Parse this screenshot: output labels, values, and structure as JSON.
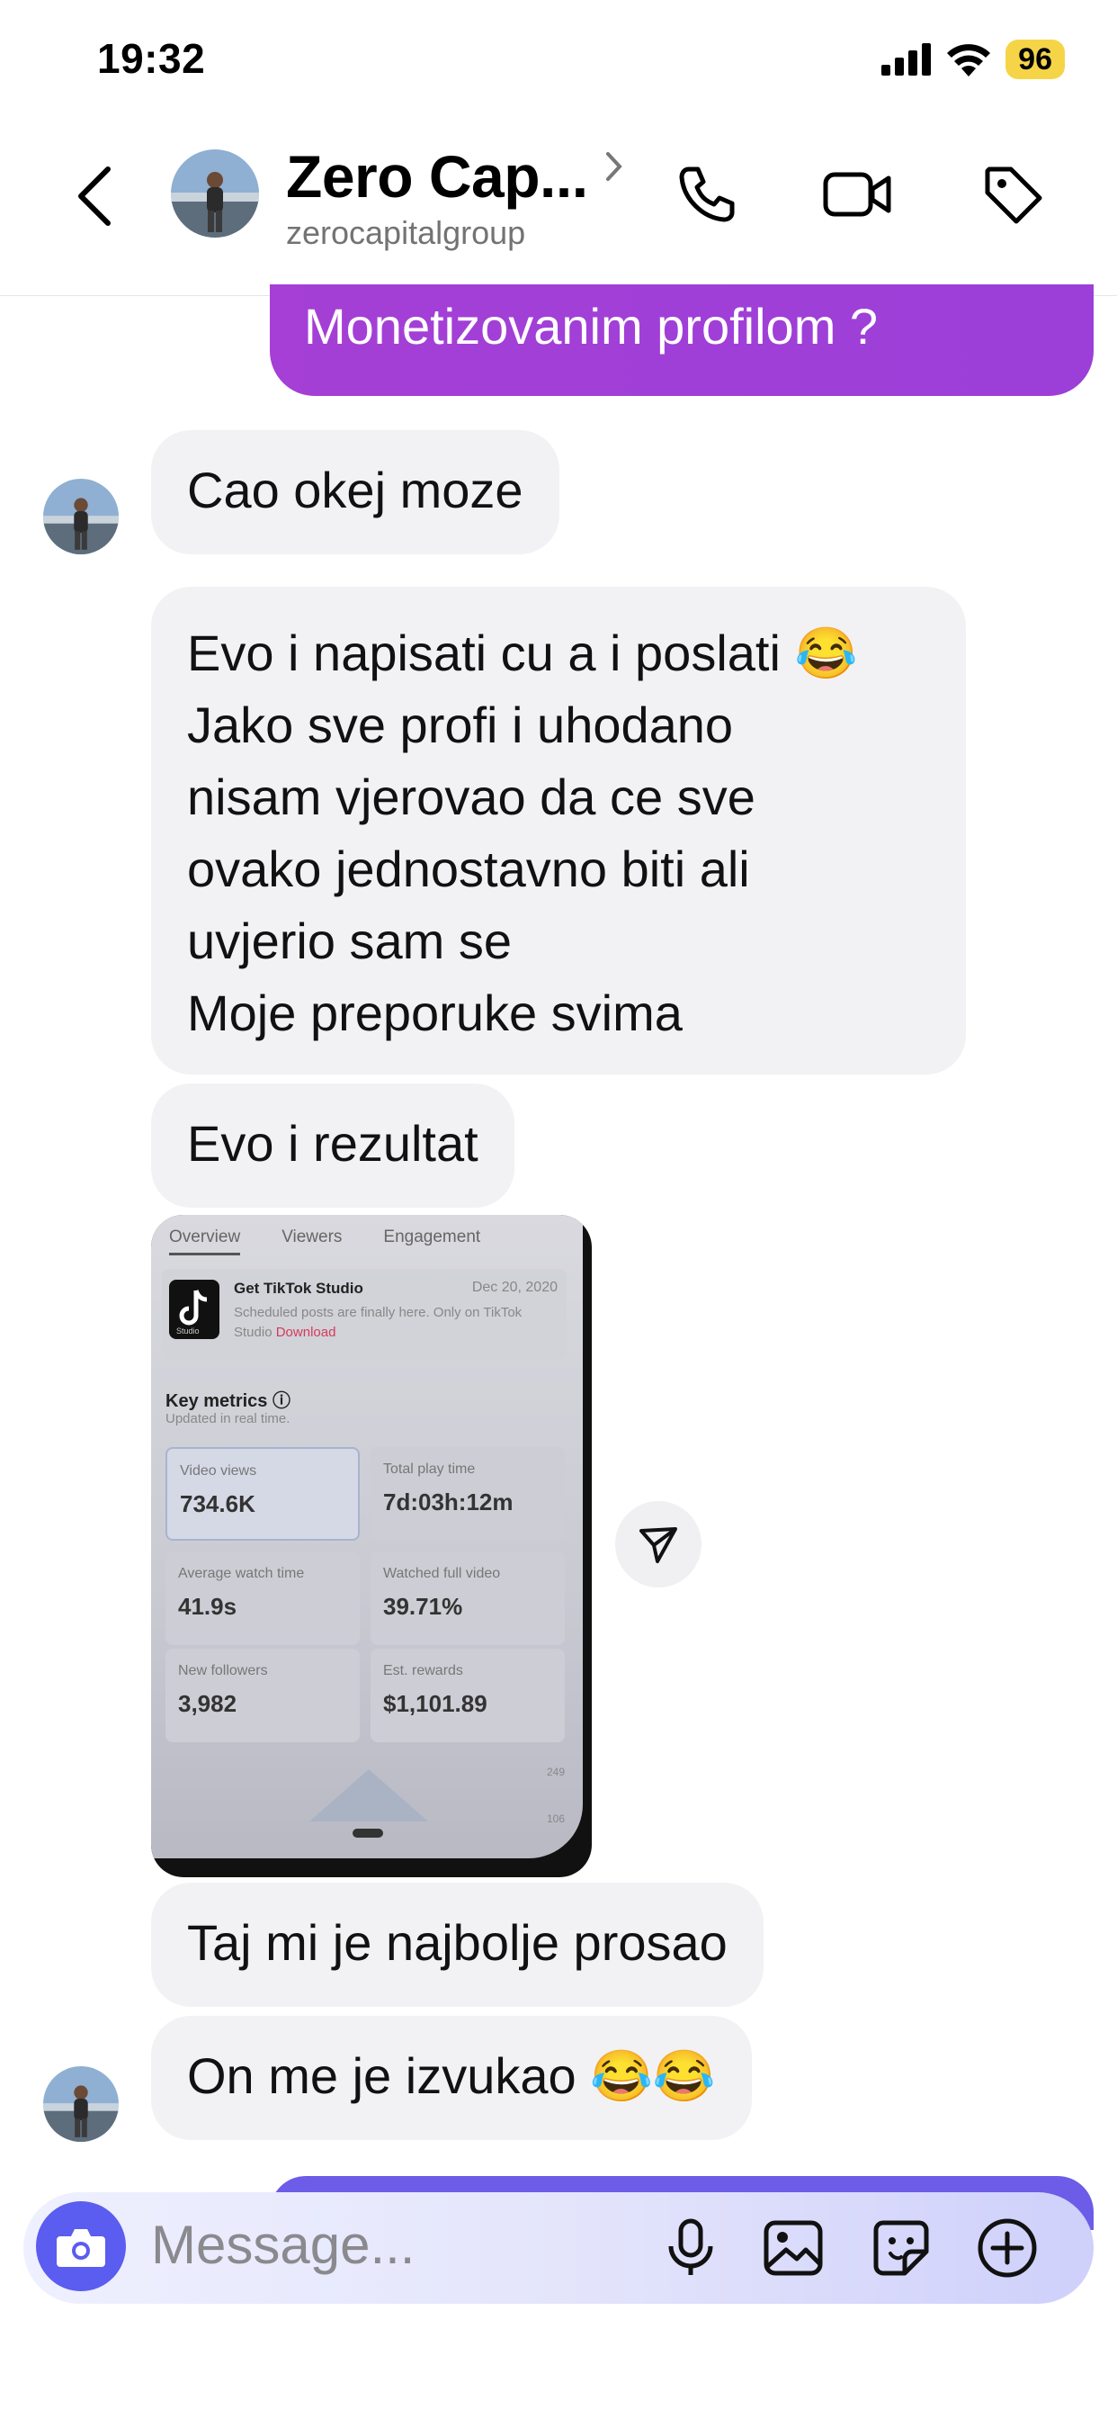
{
  "status_bar": {
    "time": "19:32",
    "battery": "96"
  },
  "header": {
    "name": "Zero Cap...",
    "handle": "zerocapitalgroup"
  },
  "messages": {
    "sent_top": "Monetizovanim profilom ?",
    "m1": "Cao okej moze",
    "m2_lines": [
      "Evo i napisati cu a i poslati 😂",
      "Jako sve profi i uhodano",
      "nisam vjerovao da ce sve",
      "ovako jednostavno biti ali",
      "uvjerio sam se",
      "Moje preporuke svima"
    ],
    "m3": "Evo i rezultat",
    "m4": "Taj mi je najbolje prosao",
    "m5": "On me je izvukao 😂😂"
  },
  "photo": {
    "tabs": [
      "Overview",
      "Viewers",
      "Engagement"
    ],
    "card_title": "Get TikTok Studio",
    "card_date": "Dec 20, 2020",
    "card_sub": "Scheduled posts are finally here. Only on TikTok Studio",
    "card_link": "Download",
    "logo_text": "Studio",
    "key_metrics_title": "Key metrics ⓘ",
    "key_metrics_sub": "Updated in real time.",
    "metrics": [
      {
        "label": "Video views",
        "value": "734.6K"
      },
      {
        "label": "Total play time",
        "value": "7d:03h:12m"
      },
      {
        "label": "Average watch time",
        "value": "41.9s"
      },
      {
        "label": "Watched full video",
        "value": "39.71%"
      },
      {
        "label": "New followers",
        "value": "3,982"
      },
      {
        "label": "Est. rewards",
        "value": "$1,101.89"
      }
    ],
    "tiny_a": "249",
    "tiny_b": "106"
  },
  "composer": {
    "placeholder": "Message..."
  }
}
